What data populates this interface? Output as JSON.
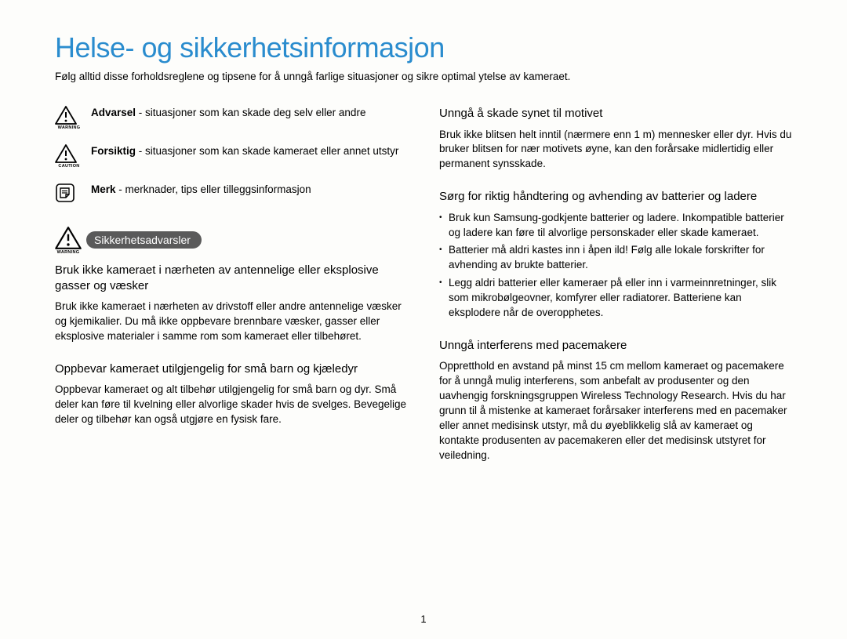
{
  "title": "Helse- og sikkerhetsinformasjon",
  "intro": "Følg alltid disse forholdsreglene og tipsene for å unngå farlige situasjoner og sikre optimal ytelse av kameraet.",
  "legend": {
    "warning": {
      "label": "Advarsel",
      "text": " - situasjoner som kan skade deg selv eller andre",
      "sublabel": "WARNING"
    },
    "caution": {
      "label": "Forsiktig",
      "text": " - situasjoner som kan skade kameraet eller annet utstyr",
      "sublabel": "CAUTION"
    },
    "note": {
      "label": "Merk",
      "text": " - merknader, tips eller tilleggsinformasjon"
    }
  },
  "safety_header": {
    "pill": "Sikkerhetsadvarsler",
    "sublabel": "WARNING"
  },
  "left": {
    "sec1": {
      "title": "Bruk ikke kameraet i nærheten av antennelige eller eksplosive gasser og væsker",
      "body": "Bruk ikke kameraet i nærheten av drivstoff eller andre antennelige væsker og kjemikalier. Du må ikke oppbevare brennbare væsker, gasser eller eksplosive materialer i samme rom som kameraet eller tilbehøret."
    },
    "sec2": {
      "title": "Oppbevar kameraet utilgjengelig for små barn og kjæledyr",
      "body": "Oppbevar kameraet og alt tilbehør utilgjengelig for små barn og dyr. Små deler kan føre til kvelning eller alvorlige skader hvis de svelges. Bevegelige deler og tilbehør kan også utgjøre en fysisk fare."
    }
  },
  "right": {
    "sec1": {
      "title": "Unngå å skade synet til motivet",
      "body": "Bruk ikke blitsen helt inntil (nærmere enn 1 m) mennesker eller dyr. Hvis du bruker blitsen for nær motivets øyne, kan den forårsake midlertidig eller permanent synsskade."
    },
    "sec2": {
      "title": "Sørg for riktig håndtering og avhending av batterier og ladere",
      "bullets": [
        "Bruk kun Samsung-godkjente batterier og ladere. Inkompatible batterier og ladere kan føre til alvorlige personskader eller skade kameraet.",
        "Batterier må aldri kastes inn i åpen ild! Følg alle lokale forskrifter for avhending av brukte batterier.",
        "Legg aldri batterier eller kameraer på eller inn i varmeinnretninger, slik som mikrobølgeovner, komfyrer eller radiatorer. Batteriene kan eksplodere når de overopphetes."
      ]
    },
    "sec3": {
      "title": "Unngå interferens med pacemakere",
      "body": "Oppretthold en avstand på minst 15 cm mellom kameraet og pacemakere for å unngå mulig interferens, som anbefalt av produsenter og den uavhengig forskningsgruppen Wireless Technology Research. Hvis du har grunn til å mistenke at kameraet forårsaker interferens med en pacemaker eller annet medisinsk utstyr, må du øyeblikkelig slå av kameraet og kontakte produsenten av pacemakeren eller det medisinsk utstyret for veiledning."
    }
  },
  "page": "1"
}
